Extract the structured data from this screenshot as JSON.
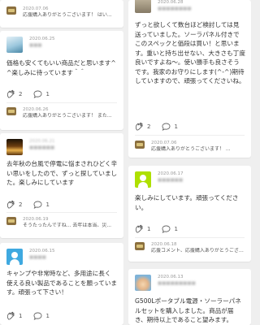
{
  "left": {
    "card1": {
      "reply_date": "2020.07.06",
      "reply_text": "応援購入ありがとうございます！ はい..."
    },
    "card2": {
      "date": "2020.06.25",
      "name": "■■■",
      "body": "価格も安くてもいい商品だと思います^ ^楽しみに待っています＾＾",
      "likes": "2",
      "comments": "1",
      "reply_date": "2020.06.26",
      "reply_text": "応援購入ありがとうございます！ また..."
    },
    "card3": {
      "date": "2020.06.21",
      "name": "■■■■■■",
      "body": "去年秋の台風で停電に悩まされひどく辛い思いをしたので、ずっと探していました。楽しみにしています",
      "likes": "2",
      "comments": "1",
      "reply_date": "2020.06.19",
      "reply_text": "そうたったんですね... 去年は本当、災..."
    },
    "card4": {
      "date": "2020.06.15",
      "name": "■■■■",
      "body": "キャンプや非常時など、多用途に長く使える良い製品であることを願っています。頑張って下さい！",
      "likes": "1",
      "comments": "1"
    }
  },
  "right": {
    "card1": {
      "date": "2020.06.28",
      "name": "■■■■■■■■",
      "body": "ずっと欲しくて数台ほど検討しては見送っていました。ソーラパネル付きでこのスペックと価段は買い！と思います。重いと持ち出せない、大きさも丁度良いですよね〜。使い勝手も良さそうです。我家のお守りにします(^-^)期待していますので、頑張ってくださいね。",
      "likes": "2",
      "comments": "1",
      "reply_date": "2020.07.06",
      "reply_text": "応援購入ありがとうございます！ ..."
    },
    "card2": {
      "date": "2020.06.17",
      "name": "■■■■■■",
      "body": "楽しみにしています。頑張ってください。",
      "likes": "1",
      "comments": "1",
      "reply_date": "2020.06.18",
      "reply_text": "応援コメント、応援購入ありがとうござい..."
    },
    "card3": {
      "date": "2020.06.13",
      "name": "■■■■■■■■■",
      "body": "G500Lポータブル電源・ソーラーパネルセットを購入しました。商品が届き、期待以上であること望みます。"
    }
  },
  "icons": {
    "like": "clap-icon",
    "comment": "speech-bubble-icon"
  },
  "colors": {
    "background": "#efefef",
    "card": "#ffffff",
    "avatar_teal": "#3fa9e0",
    "avatar_green": "#aee000"
  }
}
